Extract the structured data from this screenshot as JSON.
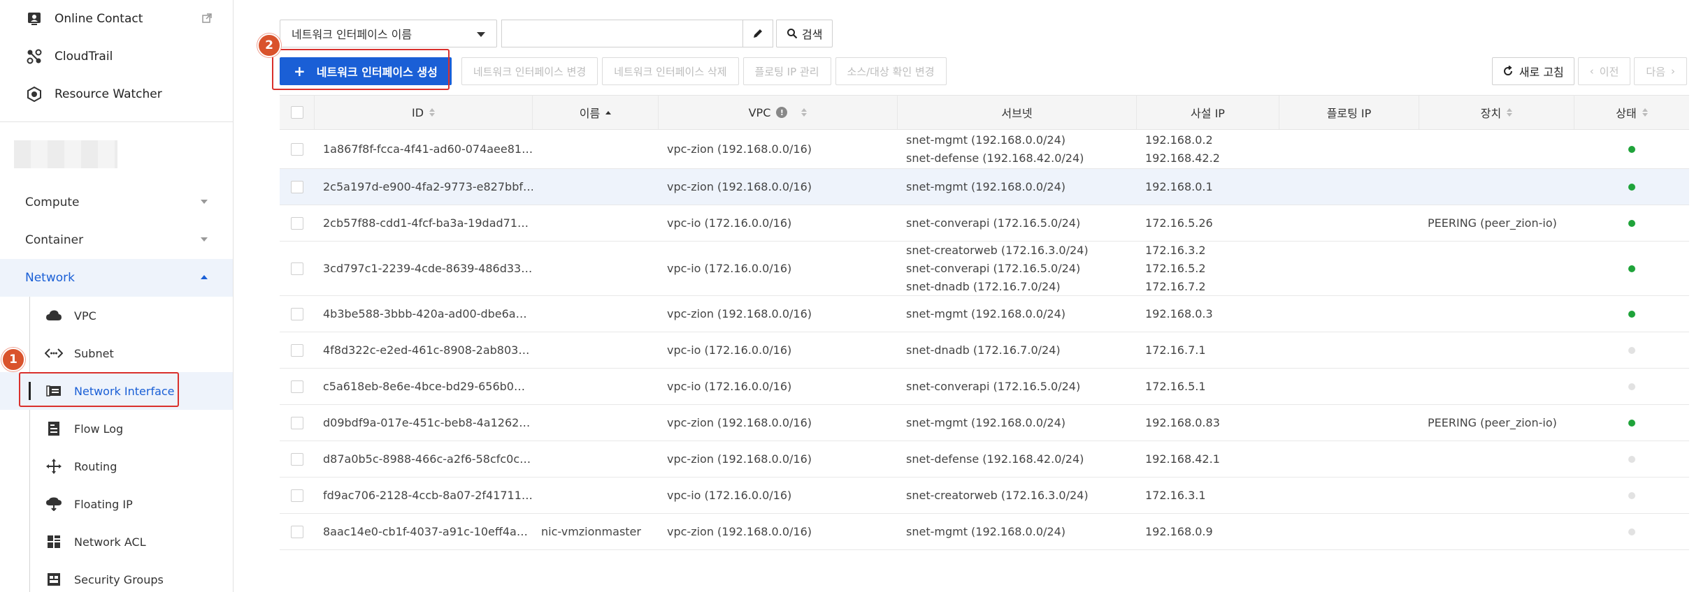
{
  "sidebar": {
    "top_items": [
      {
        "label": "Online Contact",
        "icon": "online-contact-icon"
      },
      {
        "label": "CloudTrail",
        "icon": "cloudtrail-icon"
      },
      {
        "label": "Resource Watcher",
        "icon": "resource-watcher-icon"
      }
    ],
    "categories": [
      {
        "label": "Compute"
      },
      {
        "label": "Container"
      },
      {
        "label": "Network"
      }
    ],
    "network_items": [
      {
        "label": "VPC",
        "icon": "cloud-icon"
      },
      {
        "label": "Subnet",
        "icon": "subnet-icon"
      },
      {
        "label": "Network Interface",
        "icon": "network-interface-icon"
      },
      {
        "label": "Flow Log",
        "icon": "flow-log-icon"
      },
      {
        "label": "Routing",
        "icon": "routing-icon"
      },
      {
        "label": "Floating IP",
        "icon": "floating-ip-icon"
      },
      {
        "label": "Network ACL",
        "icon": "network-acl-icon"
      },
      {
        "label": "Security Groups",
        "icon": "security-groups-icon"
      }
    ]
  },
  "badges": {
    "one": "1",
    "two": "2"
  },
  "search": {
    "select_value": "네트워크 인터페이스 이름",
    "input_value": "",
    "search_label": "검색"
  },
  "toolbar": {
    "create_label": "네트워크 인터페이스 생성",
    "edit_label": "네트워크 인터페이스 변경",
    "delete_label": "네트워크 인터페이스 삭제",
    "floating_label": "플로팅 IP 관리",
    "srcdst_label": "소스/대상 확인 변경",
    "refresh_label": "새로 고침",
    "prev_label": "이전",
    "next_label": "다음"
  },
  "table": {
    "headers": {
      "id": "ID",
      "name": "이름",
      "vpc": "VPC",
      "subnet": "서브넷",
      "private_ip": "사설 IP",
      "floating_ip": "플로팅 IP",
      "device": "장치",
      "status": "상태"
    },
    "rows": [
      {
        "id": "1a867f8f-fcca-4f41-ad60-074aee81…",
        "name": "",
        "vpc": "vpc-zion (192.168.0.0/16)",
        "subnets": [
          "snet-mgmt (192.168.0.0/24)",
          "snet-defense (192.168.42.0/24)"
        ],
        "ips": [
          "192.168.0.2",
          "192.168.42.2"
        ],
        "floating": "",
        "device": "",
        "status": "on"
      },
      {
        "id": "2c5a197d-e900-4fa2-9773-e827bbf…",
        "name": "",
        "vpc": "vpc-zion (192.168.0.0/16)",
        "subnets": [
          "snet-mgmt (192.168.0.0/24)"
        ],
        "ips": [
          "192.168.0.1"
        ],
        "floating": "",
        "device": "",
        "status": "on"
      },
      {
        "id": "2cb57f88-cdd1-4fcf-ba3a-19dad71…",
        "name": "",
        "vpc": "vpc-io (172.16.0.0/16)",
        "subnets": [
          "snet-converapi (172.16.5.0/24)"
        ],
        "ips": [
          "172.16.5.26"
        ],
        "floating": "",
        "device": "PEERING (peer_zion-io)",
        "status": "on"
      },
      {
        "id": "3cd797c1-2239-4cde-8639-486d33…",
        "name": "",
        "vpc": "vpc-io (172.16.0.0/16)",
        "subnets": [
          "snet-creatorweb (172.16.3.0/24)",
          "snet-converapi (172.16.5.0/24)",
          "snet-dnadb (172.16.7.0/24)"
        ],
        "ips": [
          "172.16.3.2",
          "172.16.5.2",
          "172.16.7.2"
        ],
        "floating": "",
        "device": "",
        "status": "on"
      },
      {
        "id": "4b3be588-3bbb-420a-ad00-dbe6a…",
        "name": "",
        "vpc": "vpc-zion (192.168.0.0/16)",
        "subnets": [
          "snet-mgmt (192.168.0.0/24)"
        ],
        "ips": [
          "192.168.0.3"
        ],
        "floating": "",
        "device": "",
        "status": "on"
      },
      {
        "id": "4f8d322c-e2ed-461c-8908-2ab803…",
        "name": "",
        "vpc": "vpc-io (172.16.0.0/16)",
        "subnets": [
          "snet-dnadb (172.16.7.0/24)"
        ],
        "ips": [
          "172.16.7.1"
        ],
        "floating": "",
        "device": "",
        "status": "off"
      },
      {
        "id": "c5a618eb-8e6e-4bce-bd29-656b0…",
        "name": "",
        "vpc": "vpc-io (172.16.0.0/16)",
        "subnets": [
          "snet-converapi (172.16.5.0/24)"
        ],
        "ips": [
          "172.16.5.1"
        ],
        "floating": "",
        "device": "",
        "status": "off"
      },
      {
        "id": "d09bdf9a-017e-451c-beb8-4a1262…",
        "name": "",
        "vpc": "vpc-zion (192.168.0.0/16)",
        "subnets": [
          "snet-mgmt (192.168.0.0/24)"
        ],
        "ips": [
          "192.168.0.83"
        ],
        "floating": "",
        "device": "PEERING (peer_zion-io)",
        "status": "on"
      },
      {
        "id": "d87a0b5c-8988-466c-a2f6-58cfc0c…",
        "name": "",
        "vpc": "vpc-zion (192.168.0.0/16)",
        "subnets": [
          "snet-defense (192.168.42.0/24)"
        ],
        "ips": [
          "192.168.42.1"
        ],
        "floating": "",
        "device": "",
        "status": "off"
      },
      {
        "id": "fd9ac706-2128-4ccb-8a07-2f41711…",
        "name": "",
        "vpc": "vpc-io (172.16.0.0/16)",
        "subnets": [
          "snet-creatorweb (172.16.3.0/24)"
        ],
        "ips": [
          "172.16.3.1"
        ],
        "floating": "",
        "device": "",
        "status": "off"
      },
      {
        "id": "8aac14e0-cb1f-4037-a91c-10eff4a…",
        "name": "nic-vmzionmaster",
        "vpc": "vpc-zion (192.168.0.0/16)",
        "subnets": [
          "snet-mgmt (192.168.0.0/24)"
        ],
        "ips": [
          "192.168.0.9"
        ],
        "floating": "",
        "device": "",
        "status": "off"
      }
    ]
  },
  "colors": {
    "accent": "#1a5fd6",
    "status_on": "#1fa33a",
    "status_off": "#e2e2e2",
    "highlight": "#d9302c"
  }
}
